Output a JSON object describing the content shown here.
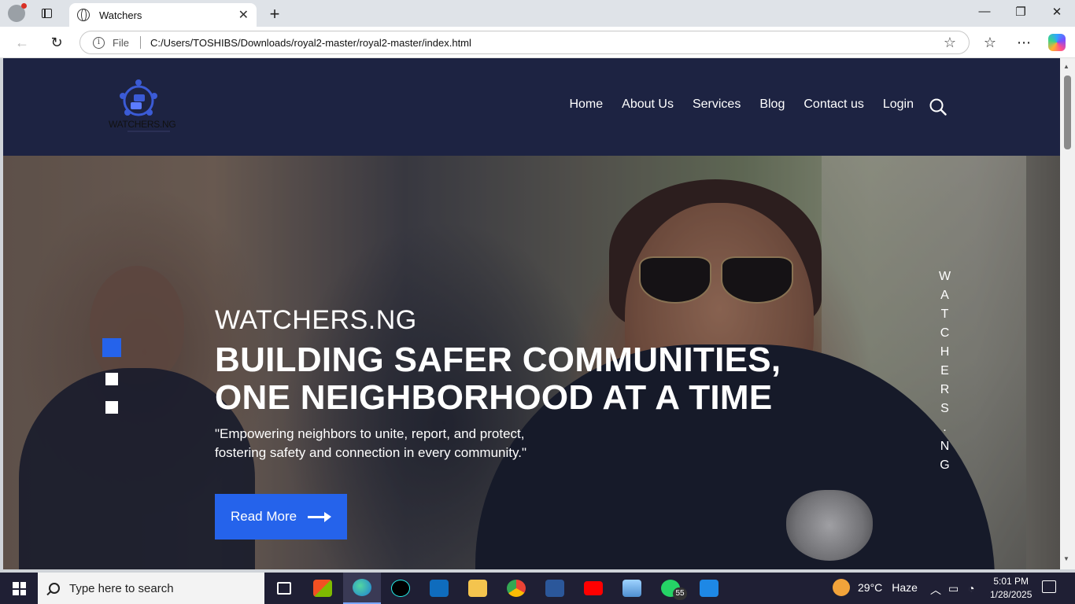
{
  "browser": {
    "tab_title": "Watchers",
    "tab_close": "✕",
    "new_tab": "+",
    "url_scheme": "File",
    "url": "C:/Users/TOSHIBS/Downloads/royal2-master/royal2-master/index.html",
    "window_controls": {
      "minimize": "—",
      "restore": "❐",
      "close": "✕"
    }
  },
  "site": {
    "logo_text": "WATCHERS.NG",
    "nav": [
      "Home",
      "About Us",
      "Services",
      "Blog",
      "Contact us",
      "Login"
    ],
    "hero": {
      "eyebrow": "WATCHERS.NG",
      "headline": "BUILDING SAFER COMMUNITIES, ONE NEIGHBORHOOD AT A TIME",
      "tagline": "\"Empowering neighbors to unite, report, and protect, fostering safety and connection in every community.\"",
      "cta": "Read More",
      "vertical_text": [
        "W",
        "A",
        "T",
        "C",
        "H",
        "E",
        "R",
        "S",
        ".",
        "N",
        "G"
      ],
      "slide_indicator": {
        "active": 1,
        "total": 3
      }
    },
    "colors": {
      "header_bg": "#1d2342",
      "accent": "#2563eb"
    }
  },
  "taskbar": {
    "search_placeholder": "Type here to search",
    "apps": [
      "task-view",
      "microsoft-store",
      "edge",
      "tiktok",
      "outlook",
      "file-explorer",
      "chrome",
      "word",
      "youtube",
      "photos",
      "whatsapp",
      "vscode"
    ],
    "whatsapp_badge": "55",
    "weather": {
      "temp": "29°C",
      "condition": "Haze"
    },
    "time": "5:01 PM",
    "date": "1/28/2025"
  }
}
